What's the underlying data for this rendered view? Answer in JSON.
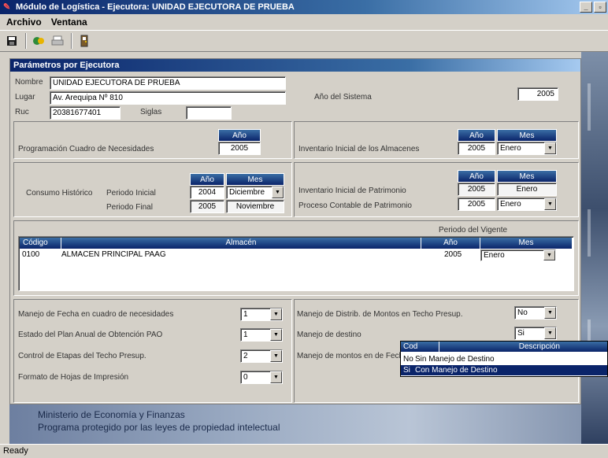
{
  "window": {
    "title": "Módulo de Logística - Ejecutora: UNIDAD EJECUTORA DE PRUEBA",
    "btn_min": "_",
    "btn_max": "▫"
  },
  "menu": [
    "Archivo",
    "Ventana"
  ],
  "toolbar": {
    "icons": [
      "save-icon",
      "refresh-icon",
      "print-icon",
      "exit-icon"
    ]
  },
  "panel": {
    "title": "Parámetros por Ejecutora",
    "nombre_label": "Nombre",
    "nombre": "UNIDAD EJECUTORA DE PRUEBA",
    "lugar_label": "Lugar",
    "lugar": "Av. Arequipa Nº 810",
    "ruc_label": "Ruc",
    "ruc": "20381677401",
    "siglas_label": "Siglas",
    "siglas": "",
    "anio_sistema_label": "Año del Sistema",
    "anio_sistema": "2005"
  },
  "programacion": {
    "label": "Programación Cuadro de Necesidades",
    "hdr_anio": "Año",
    "anio": "2005"
  },
  "inventario_almacenes": {
    "label": "Inventario Inicial de los Almacenes",
    "hdr_anio": "Año",
    "hdr_mes": "Mes",
    "anio": "2005",
    "mes": "Enero"
  },
  "consumo": {
    "label": "Consumo Histórico",
    "hdr_anio": "Año",
    "hdr_mes": "Mes",
    "inicial_label": "Periodo Inicial",
    "inicial_anio": "2004",
    "inicial_mes": "Diciembre",
    "final_label": "Periodo Final",
    "final_anio": "2005",
    "final_mes": "Noviembre"
  },
  "patrimonio": {
    "hdr_anio": "Año",
    "hdr_mes": "Mes",
    "inventario_label": "Inventario Inicial de Patrimonio",
    "inventario_anio": "2005",
    "inventario_mes": "Enero",
    "proceso_label": "Proceso Contable de Patrimonio",
    "proceso_anio": "2005",
    "proceso_mes": "Enero"
  },
  "periodo_vigente": {
    "label": "Periodo del Vigente",
    "columns": [
      "Código",
      "Almacén",
      "Año",
      "Mes"
    ],
    "rows": [
      {
        "codigo": "0100",
        "almacen": "ALMACEN PRINCIPAL PAAG",
        "anio": "2005",
        "mes": "Enero"
      }
    ]
  },
  "opciones": {
    "manejo_fecha_label": "Manejo de Fecha en cuadro de necesidades",
    "manejo_fecha": "1",
    "estado_plan_label": "Estado del Plan Anual de Obtención PAO",
    "estado_plan": "1",
    "control_etapas_label": "Control de Etapas del Techo Presup.",
    "control_etapas": "2",
    "formato_label": "Formato de Hojas de Impresión",
    "formato": "0",
    "distrib_label": "Manejo de Distrib. de Montos en Techo Presup.",
    "distrib": "No",
    "destino_label": "Manejo de destino",
    "destino": "Si",
    "montos_label": "Manejo de montos en de Fecha"
  },
  "destino_dropdown": {
    "hdr_cod": "Cod",
    "hdr_desc": "Descripción",
    "items": [
      {
        "cod": "No",
        "desc": "Sin Manejo de Destino"
      },
      {
        "cod": "Si",
        "desc": "Con Manejo de Destino"
      }
    ]
  },
  "banner": {
    "line1": "Ministerio de Economía y Finanzas",
    "line2": "Programa protegido por las leyes de propiedad intelectual"
  },
  "status": "Ready"
}
